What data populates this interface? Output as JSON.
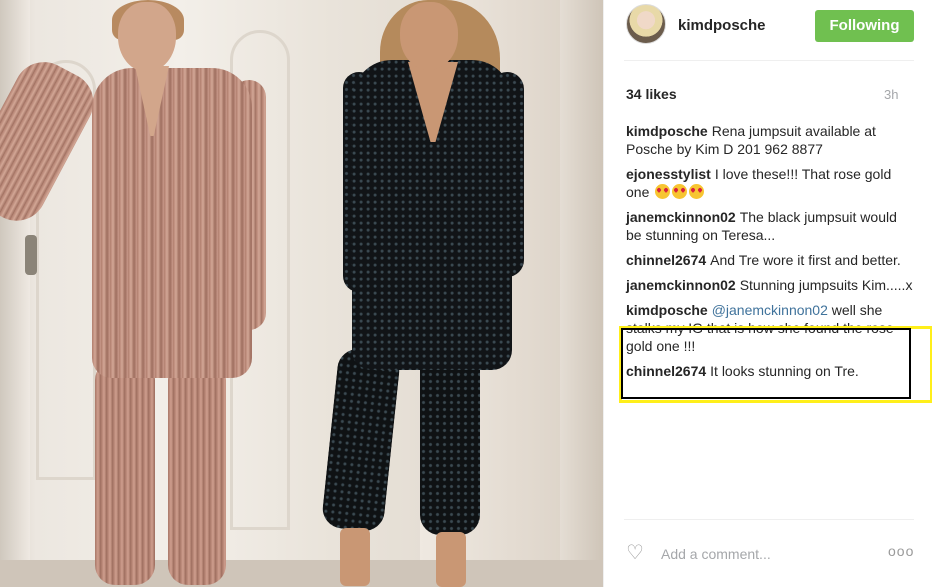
{
  "post": {
    "username": "kimdposche",
    "follow_label": "Following",
    "likes": "34 likes",
    "time": "3h",
    "photo_alt": "Two women in rose gold and black sequin jumpsuits"
  },
  "comments": [
    {
      "user": "kimdposche",
      "text": "Rena jumpsuit available at Posche by Kim D 201 962 8877"
    },
    {
      "user": "ejonesstylist",
      "text": "I love these!!! That rose gold one",
      "emoji": [
        "heart-eyes-emoji",
        "heart-eyes-emoji",
        "heart-eyes-emoji"
      ]
    },
    {
      "user": "janemckinnon02",
      "text": "The black jumpsuit would be stunning on Teresa..."
    },
    {
      "user": "chinnel2674",
      "text": "And Tre wore it first and better."
    },
    {
      "user": "janemckinnon02",
      "text": "Stunning jumpsuits Kim.....x"
    },
    {
      "user": "kimdposche",
      "mention": "@janemckinnon02",
      "text": "well she stalks my IG that is how she found the rose gold one !!!"
    },
    {
      "user": "chinnel2674",
      "text": "It looks stunning on Tre."
    }
  ],
  "footer": {
    "comment_placeholder": "Add a comment...",
    "more_label": "ooo"
  },
  "colors": {
    "follow_button": "#70c050",
    "mention": "#3f729b",
    "highlight_outer": "#ffef1a",
    "highlight_inner": "#000000"
  }
}
